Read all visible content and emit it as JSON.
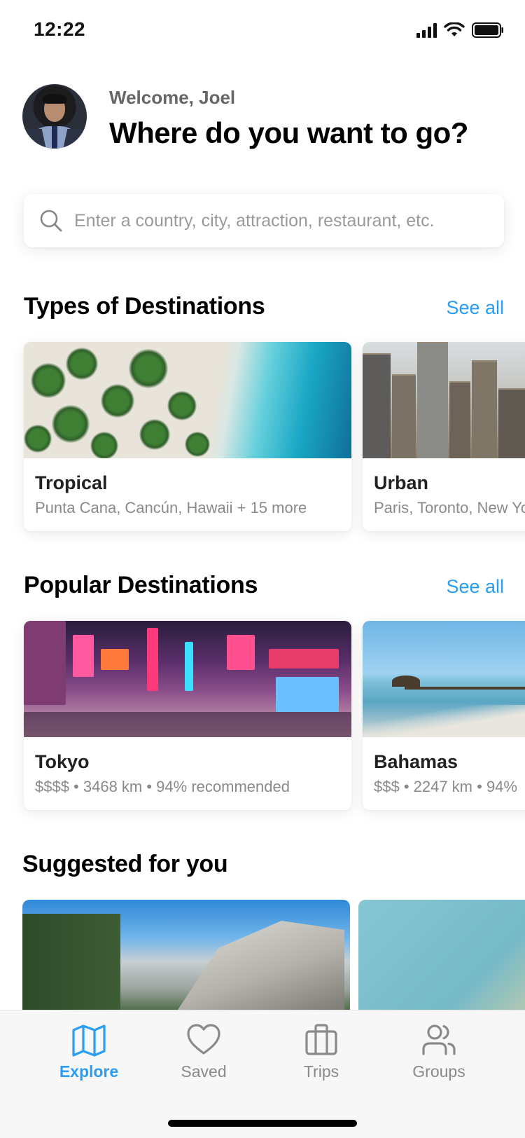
{
  "status_bar": {
    "time": "12:22"
  },
  "header": {
    "welcome": "Welcome, Joel",
    "headline": "Where do you want to go?"
  },
  "search": {
    "placeholder": "Enter a country, city, attraction, restaurant, etc.",
    "value": ""
  },
  "types_section": {
    "title": "Types of Destinations",
    "see_all": "See all",
    "cards": [
      {
        "title": "Tropical",
        "subtitle": "Punta Cana, Cancún, Hawaii + 15 more"
      },
      {
        "title": "Urban",
        "subtitle": "Paris, Toronto,  New York"
      }
    ]
  },
  "popular_section": {
    "title": "Popular Destinations",
    "see_all": "See all",
    "cards": [
      {
        "title": "Tokyo",
        "subtitle": "$$$$ • 3468 km • 94%  recommended"
      },
      {
        "title": "Bahamas",
        "subtitle": "$$$ • 2247 km • 94%"
      }
    ]
  },
  "suggested_section": {
    "title": "Suggested for you"
  },
  "tab_bar": {
    "tabs": [
      {
        "label": "Explore",
        "icon": "map-icon",
        "active": true
      },
      {
        "label": "Saved",
        "icon": "heart-icon",
        "active": false
      },
      {
        "label": "Trips",
        "icon": "briefcase-icon",
        "active": false
      },
      {
        "label": "Groups",
        "icon": "users-icon",
        "active": false
      }
    ]
  },
  "colors": {
    "accent": "#2a9df4",
    "inactive": "#8a8a8a",
    "tab_bar_bg": "#f7f7f7"
  }
}
